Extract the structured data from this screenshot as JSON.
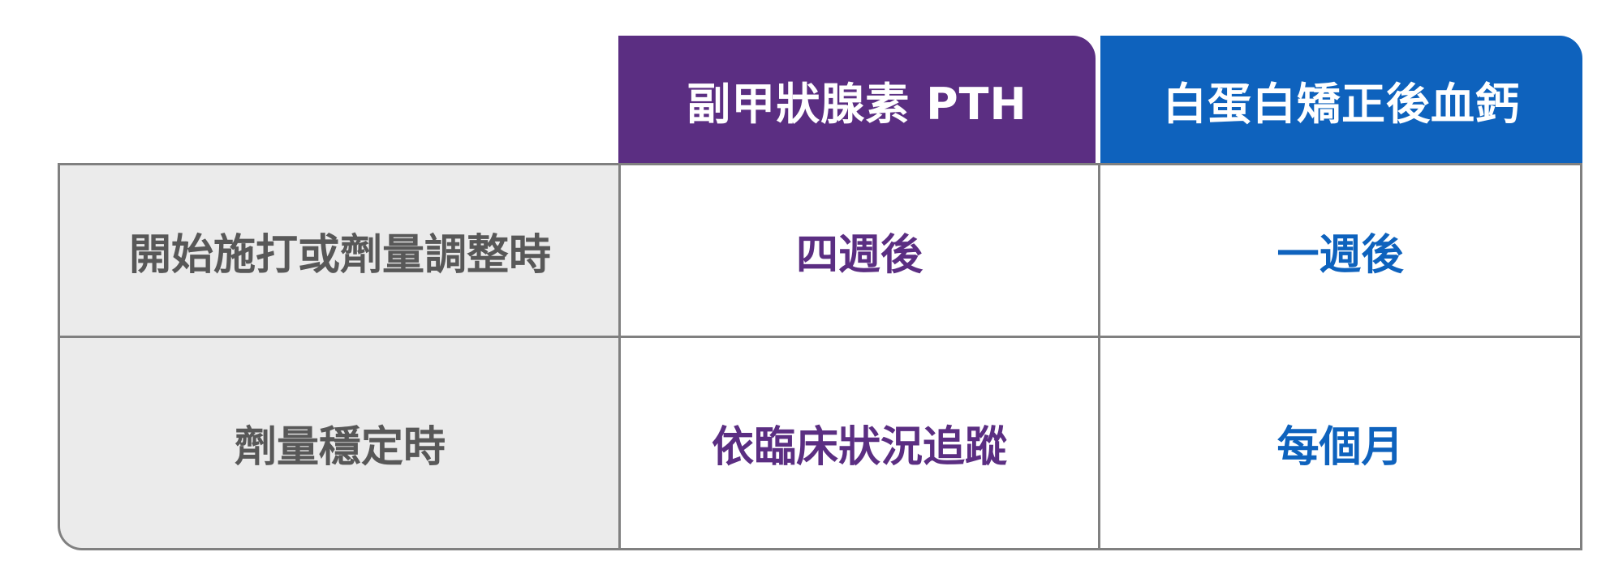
{
  "table": {
    "columns": [
      {
        "label": "副甲狀腺素 PTH",
        "color": "#5b2e82"
      },
      {
        "label": "白蛋白矯正後血鈣",
        "color": "#0e62bd"
      }
    ],
    "rows": [
      {
        "label": "開始施打或劑量調整時",
        "values": [
          "四週後",
          "一週後"
        ]
      },
      {
        "label": "劑量穩定時",
        "values": [
          "依臨床狀況追蹤",
          "每個月"
        ]
      }
    ]
  }
}
